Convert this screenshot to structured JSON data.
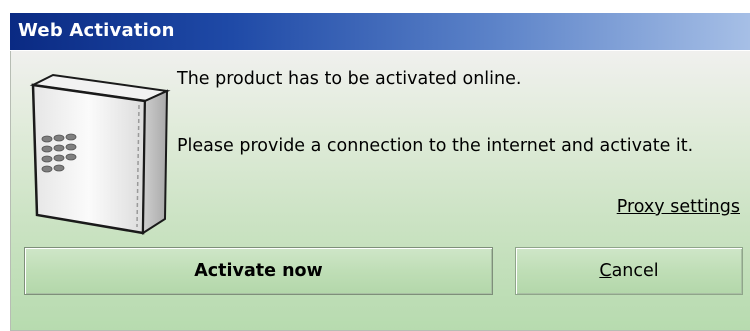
{
  "window": {
    "title": "Web Activation"
  },
  "message": {
    "line1": "The product has to be activated online.",
    "line2": "Please provide a connection to the internet and activate it."
  },
  "links": {
    "proxy_settings": "Proxy settings"
  },
  "buttons": {
    "activate": "Activate now",
    "cancel_mnemonic": "C",
    "cancel_rest": "ancel"
  },
  "icons": {
    "device": "hardware-dongle-icon"
  },
  "colors": {
    "title_bar_start": "#0a2a83",
    "title_bar_end": "#a6bfe6",
    "body_green": "#b7dbaf"
  }
}
